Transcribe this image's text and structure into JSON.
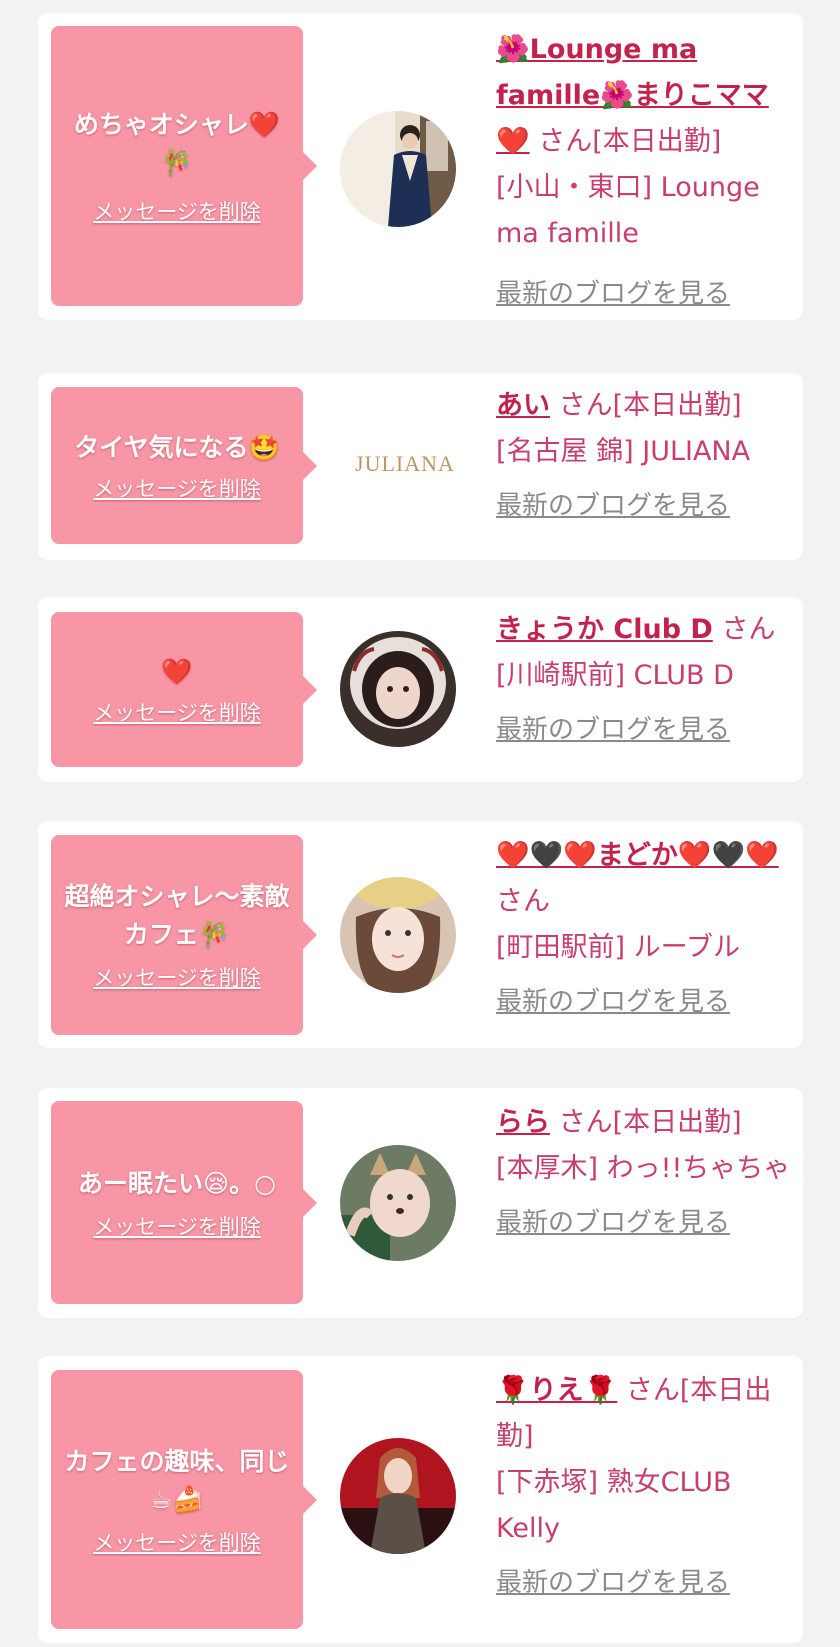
{
  "delete_label": "メッセージを削除",
  "blog_label": "最新のブログを見る",
  "san_suffix": "さん",
  "items": [
    {
      "message": "めちゃオシャレ❤️🎋",
      "name": "🌺Lounge ma famille🌺まりこママ❤️",
      "attendance": "[本日出勤]",
      "shop": "[小山・東口] Lounge ma famille",
      "avatar_icon": "kimono-woman-photo"
    },
    {
      "message": "タイヤ気になる🤩",
      "name": "あい",
      "attendance": "[本日出勤]",
      "shop": "[名古屋 錦] JULIANA",
      "avatar_icon": "juliana-logo",
      "logo_text": "JULIANA"
    },
    {
      "message": "❤️",
      "name": "きょうか Club D",
      "attendance": "",
      "shop": "[川崎駅前] CLUB D",
      "avatar_icon": "woman-hood-photo"
    },
    {
      "message": "超絶オシャレ〜素敵カフェ🎋",
      "name": "❤️🖤❤️まどか❤️🖤❤️",
      "attendance": "",
      "shop": "[町田駅前] ルーブル",
      "avatar_icon": "woman-bear-ears-photo"
    },
    {
      "message": "あー眠たい😪。○",
      "name": "らら",
      "attendance": "[本日出勤]",
      "shop": "[本厚木] わっ!!ちゃちゃ",
      "avatar_icon": "woman-cat-filter-photo"
    },
    {
      "message": "カフェの趣味、同じ☕🍰",
      "name": "🌹りえ🌹",
      "attendance": "[本日出勤]",
      "shop": "[下赤塚] 熟女CLUB Kelly",
      "avatar_icon": "woman-red-room-photo"
    }
  ],
  "colors": {
    "background": "#f2f2f2",
    "bubble": "#f896a5",
    "name": "#c3224d",
    "text": "#c83e6e",
    "blog_link": "#8a8a8a"
  }
}
